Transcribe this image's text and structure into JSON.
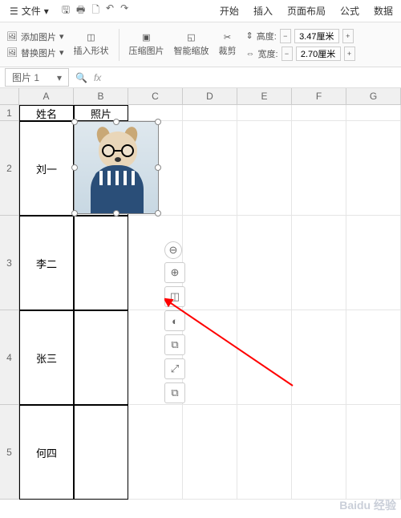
{
  "menubar": {
    "file_label": "文件",
    "tabs": [
      "开始",
      "插入",
      "页面布局",
      "公式",
      "数据"
    ]
  },
  "ribbon": {
    "add_image": "添加图片",
    "replace_image": "替换图片",
    "insert_shape": "插入形状",
    "compress": "压缩图片",
    "smart_zoom": "智能缩放",
    "crop": "裁剪",
    "height_label": "高度:",
    "height_value": "3.47厘米",
    "width_label": "宽度:",
    "width_value": "2.70厘米"
  },
  "namebox": "图片 1",
  "fx_label": "fx",
  "columns": [
    "A",
    "B",
    "C",
    "D",
    "E",
    "F",
    "G"
  ],
  "rows": {
    "1": {
      "A": "姓名",
      "B": "照片"
    },
    "2": {
      "A": "刘一"
    },
    "3": {
      "A": "李二"
    },
    "4": {
      "A": "张三"
    },
    "5": {
      "A": "何四"
    }
  },
  "float_icons": {
    "collapse": "⊖",
    "zoom": "⊕",
    "crop": "◫",
    "bulb": "◐",
    "copy": "⧉",
    "expand": "⤢",
    "paste": "⧉"
  },
  "watermark": "Baidu 经验"
}
